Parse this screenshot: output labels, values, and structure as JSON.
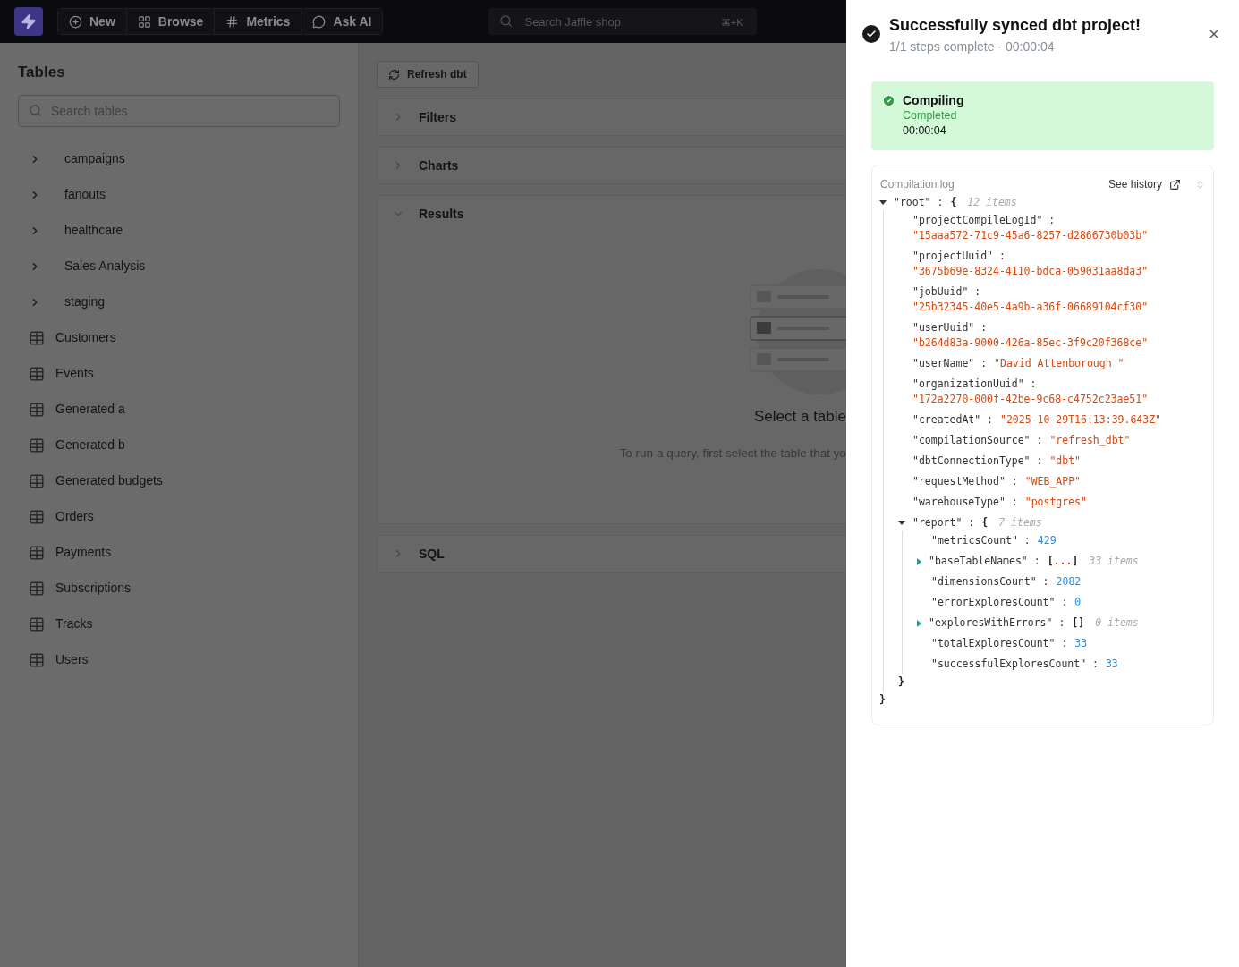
{
  "nav": {
    "items": [
      {
        "label": "New"
      },
      {
        "label": "Browse"
      },
      {
        "label": "Metrics"
      },
      {
        "label": "Ask AI"
      }
    ],
    "search": {
      "placeholder": "Search Jaffle shop",
      "shortcut": "⌘+K"
    }
  },
  "sidebar": {
    "title": "Tables",
    "search": {
      "placeholder": "Search tables"
    },
    "items": [
      {
        "label": "campaigns",
        "kind": "folder",
        "expanded": false
      },
      {
        "label": "fanouts",
        "kind": "folder",
        "expanded": false
      },
      {
        "label": "healthcare",
        "kind": "folder",
        "expanded": false
      },
      {
        "label": "Sales Analysis",
        "kind": "folder",
        "expanded": false
      },
      {
        "label": "staging",
        "kind": "folder",
        "expanded": false
      },
      {
        "label": "Customers",
        "kind": "table"
      },
      {
        "label": "Events",
        "kind": "table"
      },
      {
        "label": "Generated a",
        "kind": "table"
      },
      {
        "label": "Generated b",
        "kind": "table"
      },
      {
        "label": "Generated budgets",
        "kind": "table"
      },
      {
        "label": "Orders",
        "kind": "table"
      },
      {
        "label": "Payments",
        "kind": "table"
      },
      {
        "label": "Subscriptions",
        "kind": "table"
      },
      {
        "label": "Tracks",
        "kind": "table"
      },
      {
        "label": "Users",
        "kind": "table"
      }
    ]
  },
  "main": {
    "refresh_button": "Refresh dbt",
    "sections": [
      {
        "label": "Filters",
        "expanded": false
      },
      {
        "label": "Charts",
        "expanded": false
      },
      {
        "label": "Results",
        "expanded": true,
        "empty_state": {
          "title": "Select a table",
          "text": "To run a query, first select the table that yo"
        }
      },
      {
        "label": "SQL",
        "expanded": false
      }
    ]
  },
  "drawer": {
    "title": "Successfully synced dbt project!",
    "subtitle": "1/1 steps complete - 00:00:04",
    "step": {
      "title": "Compiling",
      "status": "Completed",
      "time": "00:00:04",
      "kind": "done"
    },
    "log": {
      "title": "Compilation log",
      "history_link": "See history",
      "tree": {
        "key": "\"root\" :",
        "open": "{",
        "count": "12 items",
        "expanded": true,
        "close": "}",
        "children": [
          {
            "key": "\"projectCompileLogId\" :",
            "value": "\"15aaa572-71c9-45a6-8257-d2866730b03b\"",
            "kind": "string"
          },
          {
            "key": "\"projectUuid\" :",
            "value": "\"3675b69e-8324-4110-bdca-059031aa8da3\"",
            "kind": "string"
          },
          {
            "key": "\"jobUuid\" :",
            "value": "\"25b32345-40e5-4a9b-a36f-06689104cf30\"",
            "kind": "string"
          },
          {
            "key": "\"userUuid\" :",
            "value": "\"b264d83a-9000-426a-85ec-3f9c20f368ce\"",
            "kind": "string"
          },
          {
            "key": "\"userName\" :",
            "value": "\"David Attenborough \"",
            "kind": "string"
          },
          {
            "key": "\"organizationUuid\" :",
            "value": "\"172a2270-000f-42be-9c68-c4752c23ae51\"",
            "kind": "string"
          },
          {
            "key": "\"createdAt\" :",
            "value": "\"2025-10-29T16:13:39.643Z\"",
            "kind": "string"
          },
          {
            "key": "\"compilationSource\" :",
            "value": "\"refresh_dbt\"",
            "kind": "string"
          },
          {
            "key": "\"dbtConnectionType\" :",
            "value": "\"dbt\"",
            "kind": "string"
          },
          {
            "key": "\"requestMethod\" :",
            "value": "\"WEB_APP\"",
            "kind": "string"
          },
          {
            "key": "\"warehouseType\" :",
            "value": "\"postgres\"",
            "kind": "string"
          },
          {
            "key": "\"report\" :",
            "kind": "object",
            "open": "{",
            "count": "7 items",
            "expanded": true,
            "close": "}",
            "children": [
              {
                "key": "\"metricsCount\" :",
                "value": "429",
                "kind": "number"
              },
              {
                "key": "\"baseTableNames\" :",
                "kind": "array",
                "open": "[",
                "ellipsis": "...",
                "close": "]",
                "count": "33 items",
                "expanded": false
              },
              {
                "key": "\"dimensionsCount\" :",
                "value": "2082",
                "kind": "number"
              },
              {
                "key": "\"errorExploresCount\" :",
                "value": "0",
                "kind": "number"
              },
              {
                "key": "\"exploresWithErrors\" :",
                "kind": "array",
                "open": "[",
                "close": "]",
                "count": "0 items",
                "expanded": false
              },
              {
                "key": "\"totalExploresCount\" :",
                "value": "33",
                "kind": "number"
              },
              {
                "key": "\"successfulExploresCount\" :",
                "value": "33",
                "kind": "number"
              }
            ]
          }
        ]
      }
    }
  }
}
